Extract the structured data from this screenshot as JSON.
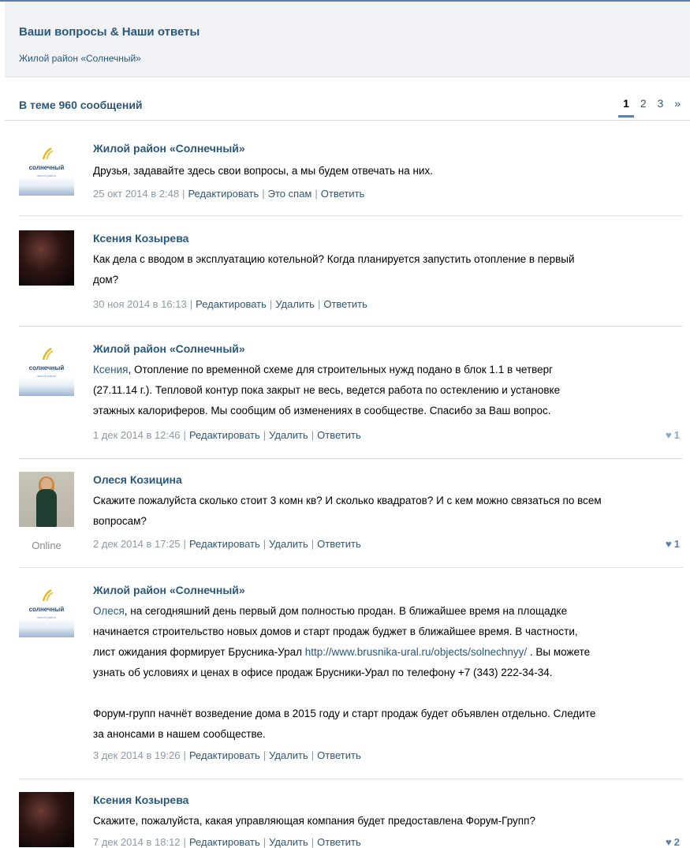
{
  "header": {
    "title": "Ваши вопросы & Наши ответы",
    "subtitle": "Жилой район «Солнечный»"
  },
  "topic": {
    "count_label": "В теме 960 сообщений",
    "pages": [
      "1",
      "2",
      "3",
      "»"
    ],
    "active_page": "1"
  },
  "logo": {
    "brand": "солнечный",
    "sub": "жилой район"
  },
  "actions": {
    "edit": "Редактировать",
    "spam": "Это спам",
    "delete": "Удалить",
    "reply": "Ответить"
  },
  "posts": [
    {
      "author": "Жилой район «Солнечный»",
      "lines": [
        "Друзья, задавайте здесь свои вопросы, а мы будем отвечать на них."
      ],
      "date": "25 окт 2014 в 2:48"
    },
    {
      "author": "Ксения Козырева",
      "lines": [
        "Как дела с вводом в эксплуатацию котельной? Когда планируется запустить отопление в первый",
        "дом?"
      ],
      "date": "30 ноя 2014 в 16:13"
    },
    {
      "author": "Жилой район «Солнечный»",
      "mention": "Ксения",
      "line1_rest": ", Отопление по временной схеме для строительных нужд подано в блок 1.1 в четверг",
      "lines": [
        "(27.11.14 г.). Тепловой контур пока закрыт не весь, ведется работа по остеклению и установке",
        "этажных калориферов. Мы сообщим об изменениях в сообществе. Спасибо за Ваш вопрос."
      ],
      "date": "1 дек 2014 в 12:46",
      "likes": "1"
    },
    {
      "author": "Олеся Козицина",
      "status": "Online",
      "lines": [
        "Скажите пожалуйста сколько стоит 3 комн кв? И сколько квадратов? И с кем можно связаться по всем",
        "вопросам?"
      ],
      "date": "2 дек 2014 в 17:25",
      "likes": "1"
    },
    {
      "author": "Жилой район «Солнечный»",
      "mention": "Олеся",
      "line1_rest": ", на сегодняшний день первый дом полностью продан. В ближайшее время на площадке",
      "line2": "начинается строительство новых домов и старт продаж буджет в ближайшее время. В частности,",
      "line3_pre": "лист ожидания формирует Брусника-Урал ",
      "link": "http://www.brusnika-ural.ru/objects/solnechnyy/",
      "line3_post": " . Вы можете",
      "line4": "узнать об условиях и ценах в офисе продаж Брусники-Урал по телефону +7 (343) 222-34-34.",
      "line5": "Форум-групп начнёт возведение дома в 2015 году и старт продаж будет объявлен отдельно. Следите",
      "line6": "за анонсами в нашем сообществе.",
      "date": "3 дек 2014 в 19:26"
    },
    {
      "author": "Ксения Козырева",
      "lines": [
        "Скажите, пожалуйста, какая управляющая компания будет предоставлена Форум-Групп?"
      ],
      "date": "7 дек 2014 в 18:12",
      "likes": "2"
    }
  ],
  "colors": {
    "accent": "#2b587a",
    "meta": "#8a9aab",
    "header_bg": "#f0f2f5"
  }
}
